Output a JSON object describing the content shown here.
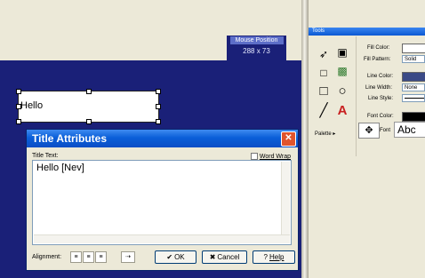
{
  "mouse_position": {
    "label": "Mouse Position",
    "value": "288 x 73"
  },
  "canvas": {
    "title_text": "Hello"
  },
  "dialog": {
    "title": "Title Attributes",
    "title_text_label": "Title Text:",
    "word_wrap_label": "Word Wrap",
    "text_value": "Hello [Nev]",
    "alignment_label": "Alignment:",
    "ok_label": "OK",
    "cancel_label": "Cancel",
    "help_label": "Help"
  },
  "tools": {
    "header": "Tools",
    "palette_label": "Palette",
    "fill_color_label": "Fill Color:",
    "fill_pattern_label": "Fill Pattern:",
    "fill_pattern_value": "Solid",
    "line_color_label": "Line Color:",
    "line_width_label": "Line Width:",
    "line_width_value": "None",
    "line_style_label": "Line Style:",
    "font_color_label": "Font Color:",
    "font_label": "Font",
    "font_sample": "Abc"
  },
  "colors": {
    "canvas_bg": "#1a2078",
    "line_color": "#3b4a86",
    "font_color": "#000000",
    "dialog_title_bar": "#0a5fd8",
    "close_button": "#e0542c"
  }
}
